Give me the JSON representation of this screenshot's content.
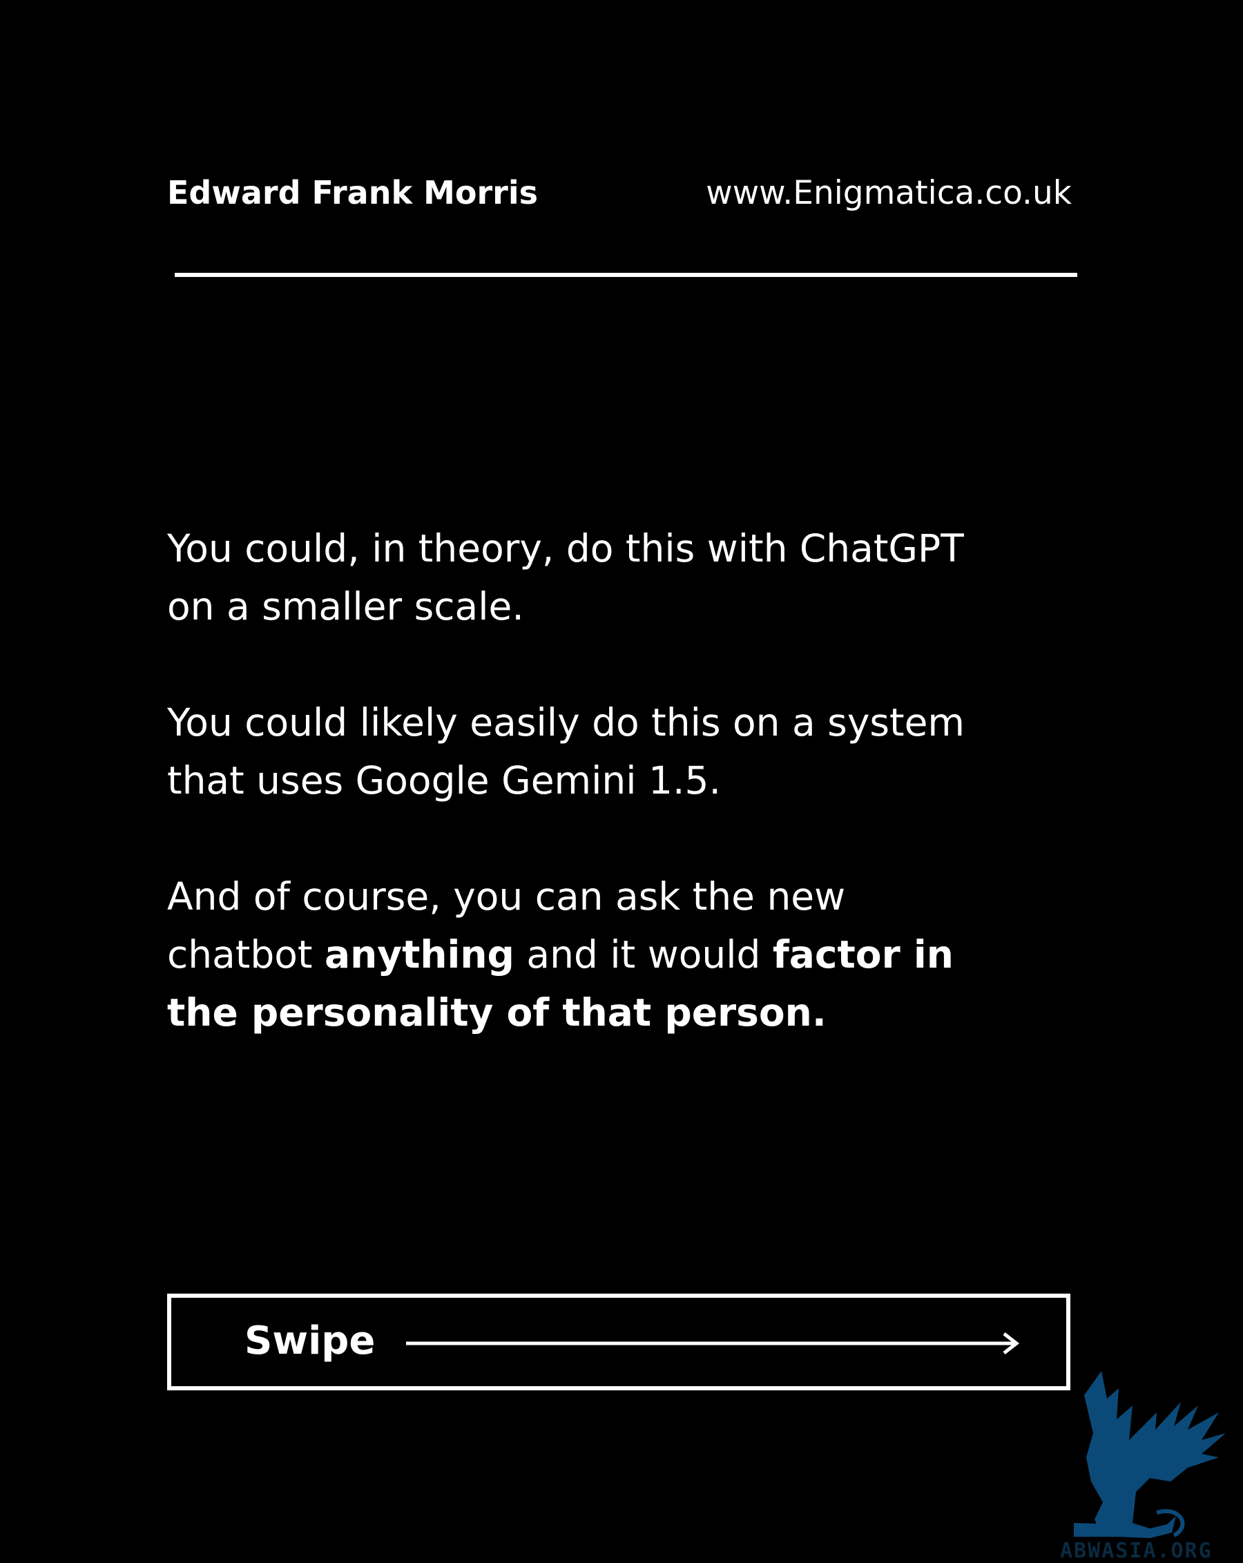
{
  "header": {
    "author": "Edward Frank Morris",
    "website": "www.Enigmatica.co.uk"
  },
  "content": {
    "p1_line1": "You could, in theory, do this with ChatGPT",
    "p1_line2": "on a smaller scale.",
    "p2_line1": "You could likely easily do this on  a system",
    "p2_line2": "that uses Google Gemini 1.5.",
    "p3_line1": "And of course, you can ask the new",
    "p3_line2_a": "chatbot ",
    "p3_line2_b": "anything",
    "p3_line2_c": " and it would ",
    "p3_line2_d": "factor in",
    "p3_line3": "the personality of that person."
  },
  "cta": {
    "label": "Swipe"
  },
  "watermark": {
    "text": "ABWASIA.ORG",
    "icon": "griffin-logo-icon",
    "color": "#0a3d62"
  },
  "colors": {
    "background": "#000000",
    "foreground": "#ffffff"
  }
}
